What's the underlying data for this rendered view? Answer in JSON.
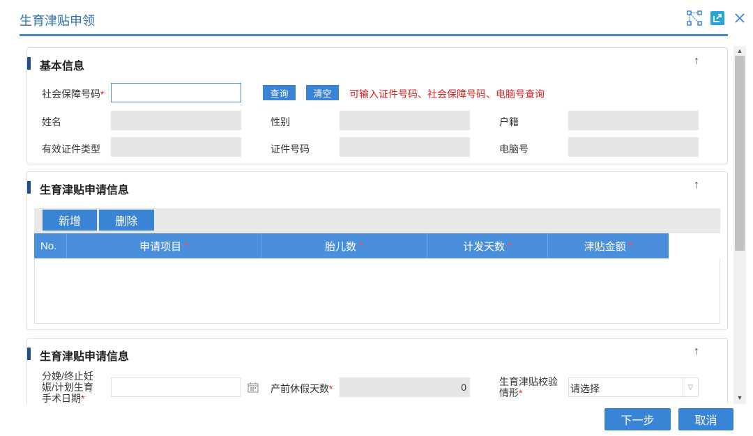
{
  "window": {
    "title": "生育津贴申领",
    "icons": [
      "network-icon",
      "external-link-icon",
      "close-icon"
    ]
  },
  "basic_info": {
    "section_title": "基本信息",
    "collapse_icon": "arrow-up-icon",
    "ssn_label": "社会保障号码",
    "ssn_value": "",
    "query_label": "查询",
    "clear_label": "清空",
    "hint": "可输入证件号码、社会保障号码、电脑号查询",
    "name_label": "姓名",
    "gender_label": "性别",
    "household_label": "户籍",
    "id_type_label": "有效证件类型",
    "id_number_label": "证件号码",
    "computer_no_label": "电脑号"
  },
  "application_grid": {
    "section_title": "生育津贴申请信息",
    "add_label": "新增",
    "delete_label": "删除",
    "columns": [
      {
        "label": "No.",
        "required": false
      },
      {
        "label": "申请项目",
        "required": true
      },
      {
        "label": "胎儿数",
        "required": true
      },
      {
        "label": "计发天数",
        "required": true
      },
      {
        "label": "津贴金额",
        "required": true
      }
    ]
  },
  "application_info": {
    "section_title": "生育津贴申请信息",
    "date_label_l1": "分娩/终止妊",
    "date_label_l2": "娠/计划生育",
    "date_label_l3": "手术日期",
    "prenatal_days_label": "产前休假天数",
    "prenatal_days_value": "0",
    "check_label_l1": "生育津贴校验",
    "check_label_l2": "情形",
    "check_select_value": "请选择"
  },
  "footer": {
    "next_label": "下一步",
    "cancel_label": "取消"
  },
  "colors": {
    "primary": "#3a84d6",
    "title": "#2d6fb0",
    "required": "#d9281d",
    "hint": "#e02020"
  }
}
